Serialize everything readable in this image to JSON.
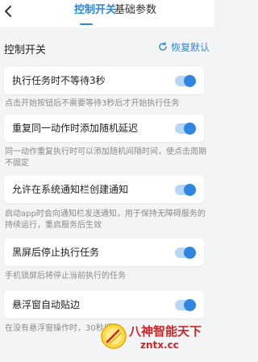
{
  "tabs": {
    "control": "控制开关",
    "basic": "基础参数"
  },
  "section": {
    "title": "控制开关",
    "restore_label": "恢复默认"
  },
  "settings": [
    {
      "label": "执行任务时不等待3秒",
      "enabled": true,
      "description": "点击开始按钮后不需要等待3秒后才开始执行任务"
    },
    {
      "label": "重复同一动作时添加随机延迟",
      "enabled": true,
      "description": "同一动作重复执行时可以添加随机间隔时间，使点击周期不固定"
    },
    {
      "label": "允许在系统通知栏创建通知",
      "enabled": true,
      "description": "启动app时会向通知栏发送通知，用于保持无障碍服务的持续运行，重启服务后生效"
    },
    {
      "label": "黑屏后停止执行任务",
      "enabled": true,
      "description": "手机锁屏后将停止当前执行的任务"
    },
    {
      "label": "悬浮窗自动贴边",
      "enabled": true,
      "description": "在没有悬浮窗操作时，30秒后"
    }
  ],
  "watermark": {
    "line1": "八神智能天下",
    "line2": "zntx.cc"
  },
  "colors": {
    "accent": "#2d86e6",
    "toggle_track": "#b8d6f5",
    "watermark": "#d81e1e"
  }
}
